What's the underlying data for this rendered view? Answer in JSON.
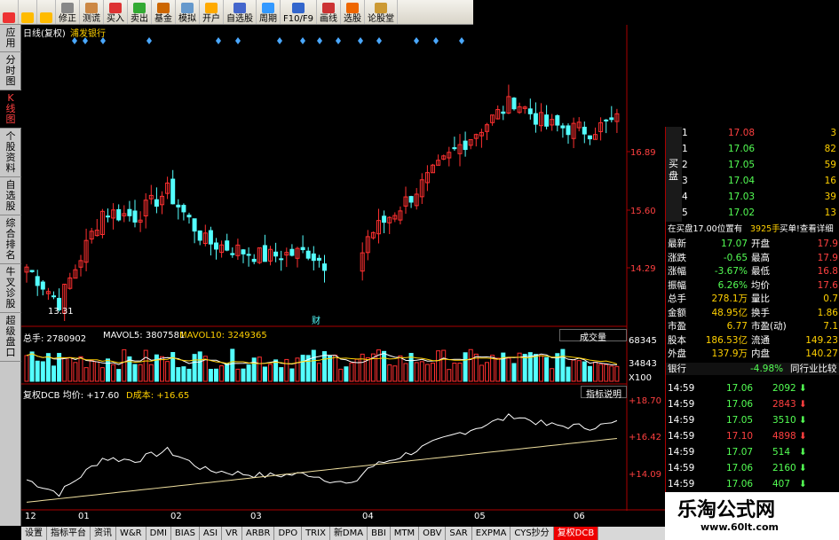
{
  "toolbar": [
    {
      "label": "",
      "icon": "color-blocks-icon"
    },
    {
      "label": "",
      "icon": "back-arrow-icon"
    },
    {
      "label": "",
      "icon": "down-arrow-icon"
    },
    {
      "label": "修正",
      "icon": "edit-icon"
    },
    {
      "label": "测谎",
      "icon": "lie-detect-icon"
    },
    {
      "label": "买入",
      "icon": "buy-icon"
    },
    {
      "label": "卖出",
      "icon": "sell-icon"
    },
    {
      "label": "基金",
      "icon": "fund-icon"
    },
    {
      "label": "模拟",
      "icon": "simulate-icon"
    },
    {
      "label": "开户",
      "icon": "account-icon"
    },
    {
      "label": "自选股",
      "icon": "watchlist-icon"
    },
    {
      "label": "周期",
      "icon": "period-icon"
    },
    {
      "label": "F10/F9",
      "icon": "f10-icon"
    },
    {
      "label": "画线",
      "icon": "draw-icon"
    },
    {
      "label": "选股",
      "icon": "select-stock-icon"
    },
    {
      "label": "论股堂",
      "icon": "forum-icon"
    }
  ],
  "vtabs": [
    {
      "label": "应用",
      "active": false
    },
    {
      "label": "分时图",
      "active": false
    },
    {
      "label": "K线图",
      "active": true
    },
    {
      "label": "个股资料",
      "active": false
    },
    {
      "label": "自选股",
      "active": false
    },
    {
      "label": "综合排名",
      "active": false
    },
    {
      "label": "牛叉诊股",
      "active": false
    },
    {
      "label": "超级盘口",
      "active": false
    }
  ],
  "chart": {
    "title": "日线(复权)",
    "stock": "浦发银行",
    "price_ticks": [
      "16.89",
      "15.60",
      "14.29"
    ],
    "low_label": "13.31",
    "event_label": "财",
    "vol_label": "总手: 2780902",
    "vol_ma5": "MAVOL5: 3807581",
    "vol_ma10": "MAVOL10: 3249365",
    "vol_btn": "成交量",
    "vol_ticks": [
      "68345",
      "34843",
      "X100"
    ],
    "dcb_label": "复权DCB 均价: +17.60",
    "dcb_cost": "D成本: +16.65",
    "dcb_btn": "指标说明",
    "dcb_ticks": [
      "+18.70",
      "+16.42",
      "+14.09"
    ],
    "months": [
      "12",
      "01",
      "02",
      "03",
      "04",
      "05",
      "06"
    ],
    "colors": {
      "up": "#ff3030",
      "down": "#54ffff",
      "ma5": "#ffffff",
      "ma10": "#ffd000",
      "avg": "#ffffff",
      "cost": "#f0e0a0"
    }
  },
  "orderbook": {
    "side_label": "买盘",
    "rows": [
      {
        "n": "1",
        "p": "17.08",
        "v": "3"
      },
      {
        "n": "1",
        "p": "17.06",
        "v": "82"
      },
      {
        "n": "2",
        "p": "17.05",
        "v": "59"
      },
      {
        "n": "3",
        "p": "17.04",
        "v": "16"
      },
      {
        "n": "4",
        "p": "17.03",
        "v": "39"
      },
      {
        "n": "5",
        "p": "17.02",
        "v": "13"
      }
    ],
    "note": "在买盘17.00位置有",
    "note_vol": "3925手",
    "note_link": "买单!查看详细"
  },
  "stats": [
    {
      "l": "最新",
      "v": "17.07",
      "l2": "开盘",
      "v2": "17.9"
    },
    {
      "l": "涨跌",
      "v": "-0.65",
      "l2": "最高",
      "v2": "17.9"
    },
    {
      "l": "涨幅",
      "v": "-3.67%",
      "l2": "最低",
      "v2": "16.8"
    },
    {
      "l": "振幅",
      "v": "6.26%",
      "l2": "均价",
      "v2": "17.6"
    },
    {
      "l": "总手",
      "v": "278.1万",
      "l2": "量比",
      "v2": "0.7"
    },
    {
      "l": "金额",
      "v": "48.95亿",
      "l2": "换手",
      "v2": "1.86"
    },
    {
      "l": "市盈",
      "v": "6.77",
      "l2": "市盈(动)",
      "v2": "7.1"
    },
    {
      "l": "股本",
      "v": "186.53亿",
      "l2": "流通",
      "v2": "149.23"
    },
    {
      "l": "外盘",
      "v": "137.9万",
      "l2": "内盘",
      "v2": "140.27"
    }
  ],
  "industry": {
    "name": "银行",
    "pct": "-4.98%",
    "link": "同行业比较"
  },
  "ticks": [
    {
      "t": "14:59",
      "p": "17.06",
      "v": "2092"
    },
    {
      "t": "14:59",
      "p": "17.06",
      "v": "2843"
    },
    {
      "t": "14:59",
      "p": "17.05",
      "v": "3510"
    },
    {
      "t": "14:59",
      "p": "17.10",
      "v": "4898"
    },
    {
      "t": "14:59",
      "p": "17.07",
      "v": "514"
    },
    {
      "t": "14:59",
      "p": "17.06",
      "v": "2160"
    },
    {
      "t": "14:59",
      "p": "17.06",
      "v": "407"
    }
  ],
  "bottom_tabs": [
    {
      "label": "设置",
      "active": false
    },
    {
      "label": "指标平台",
      "active": false
    },
    {
      "label": "资讯",
      "active": false
    },
    {
      "label": "W&R",
      "active": false
    },
    {
      "label": "DMI",
      "active": false
    },
    {
      "label": "BIAS",
      "active": false
    },
    {
      "label": "ASI",
      "active": false
    },
    {
      "label": "VR",
      "active": false
    },
    {
      "label": "ARBR",
      "active": false
    },
    {
      "label": "DPO",
      "active": false
    },
    {
      "label": "TRIX",
      "active": false
    },
    {
      "label": "新DMA",
      "active": false
    },
    {
      "label": "BBI",
      "active": false
    },
    {
      "label": "MTM",
      "active": false
    },
    {
      "label": "OBV",
      "active": false
    },
    {
      "label": "SAR",
      "active": false
    },
    {
      "label": "EXPMA",
      "active": false
    },
    {
      "label": "CYS抄分",
      "active": false
    },
    {
      "label": "复权DCB",
      "active": true
    }
  ],
  "watermark": {
    "text": "乐淘公式网",
    "url": "www.60lt.com"
  }
}
